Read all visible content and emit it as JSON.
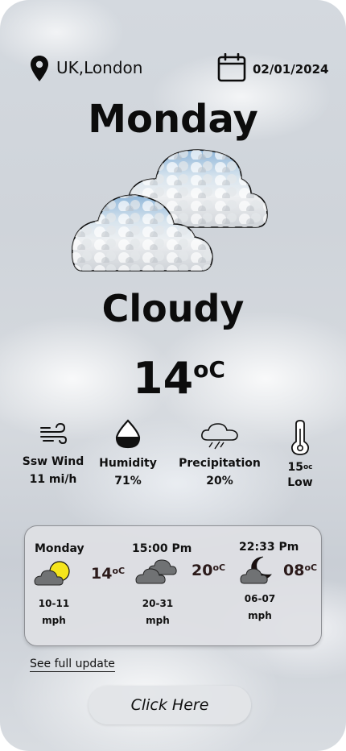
{
  "header": {
    "location": "UK,London",
    "date": "02/01/2024",
    "location_icon": "map-pin-icon",
    "date_icon": "calendar-icon"
  },
  "current": {
    "day": "Monday",
    "condition": "Cloudy",
    "temp": "14",
    "temp_unit": "oC",
    "hero_icon": "cloud-icon"
  },
  "stats": [
    {
      "icon": "wind-icon",
      "label": "Ssw Wind",
      "value": "11 mi/h"
    },
    {
      "icon": "humidity-drop-icon",
      "label": "Humidity",
      "value": "71%"
    },
    {
      "icon": "rain-cloud-icon",
      "label": "Precipitation",
      "value": "20%"
    },
    {
      "icon": "thermometer-icon",
      "temp": "15",
      "temp_unit": "oc",
      "label": "Low"
    }
  ],
  "forecast": [
    {
      "time": "Monday",
      "icon": "partly-sunny-icon",
      "temp": "14",
      "unit": "oC",
      "wind_range": "10-11",
      "wind_unit": "mph"
    },
    {
      "time": "15:00 Pm",
      "icon": "cloudy-icon",
      "temp": "20",
      "unit": "oC",
      "wind_range": "20-31",
      "wind_unit": "mph"
    },
    {
      "time": "22:33 Pm",
      "icon": "cloudy-night-icon",
      "temp": "08",
      "unit": "oC",
      "wind_range": "06-07",
      "wind_unit": "mph"
    }
  ],
  "footer": {
    "link_text": "See full update",
    "button_label": "Click Here"
  },
  "colors": {
    "sun": "#f5e51c",
    "cloud_gray": "#707274",
    "text": "#0c0c0c"
  }
}
